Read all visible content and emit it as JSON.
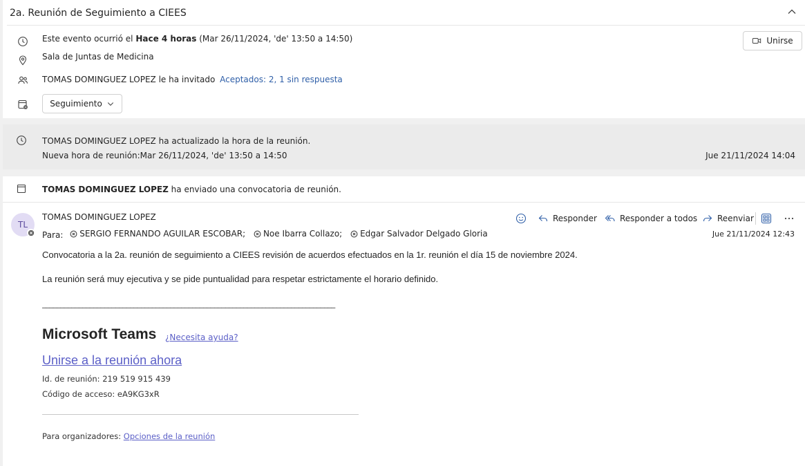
{
  "header": {
    "title": "2a. Reunión de Seguimiento a CIEES"
  },
  "event": {
    "occurred_prefix": "Este evento ocurrió el",
    "occurred_when": "Hace 4 horas",
    "occurred_detail": "(Mar 26/11/2024, 'de' 13:50 a 14:50)",
    "location": "Sala de Juntas de Medicina",
    "organizer": "TOMAS DOMINGUEZ LOPEZ",
    "invited_text": "le ha invitado",
    "responses": "Aceptados: 2, 1 sin respuesta",
    "status_dropdown": "Seguimiento",
    "join_label": "Unirse"
  },
  "update_notice": {
    "organizer": "TOMAS DOMINGUEZ LOPEZ",
    "action": "ha actualizado la hora de la reunión.",
    "new_time": "Nueva hora de reunión:Mar 26/11/2024, 'de' 13:50 a 14:50",
    "timestamp": "Jue 21/11/2024 14:04"
  },
  "invite_notice": {
    "organizer": "TOMAS DOMINGUEZ LOPEZ",
    "action": "ha enviado una convocatoria de reunión."
  },
  "message": {
    "avatar_initials": "TL",
    "sender": "TOMAS DOMINGUEZ LOPEZ",
    "to_label": "Para:",
    "recipients": [
      "SERGIO FERNANDO AGUILAR ESCOBAR;",
      "Noe Ibarra Collazo;",
      "Edgar Salvador Delgado Gloria"
    ],
    "timestamp": "Jue 21/11/2024 12:43",
    "actions": {
      "reply": "Responder",
      "reply_all": "Responder a todos",
      "forward": "Reenviar"
    },
    "body": {
      "paragraph1": "Convocatoria a la 2a. reunión de seguimiento a CIEES revisión de acuerdos efectuados en la 1r. reunión el día 15 de noviembre 2024.",
      "paragraph2": "La reunión será muy ejecutiva y se pide puntualidad para respetar estrictamente el horario definido.",
      "separator": "________________________________________________________________________________",
      "teams_title": "Microsoft Teams",
      "help_link": "¿Necesita ayuda?",
      "join_link": "Unirse a la reunión ahora",
      "meeting_id": "Id. de reunión: 219 519 915 439",
      "passcode": "Código de acceso: eA9KG3xR",
      "organizers_label": "Para organizadores:",
      "options_link": "Opciones de la reunión"
    }
  }
}
